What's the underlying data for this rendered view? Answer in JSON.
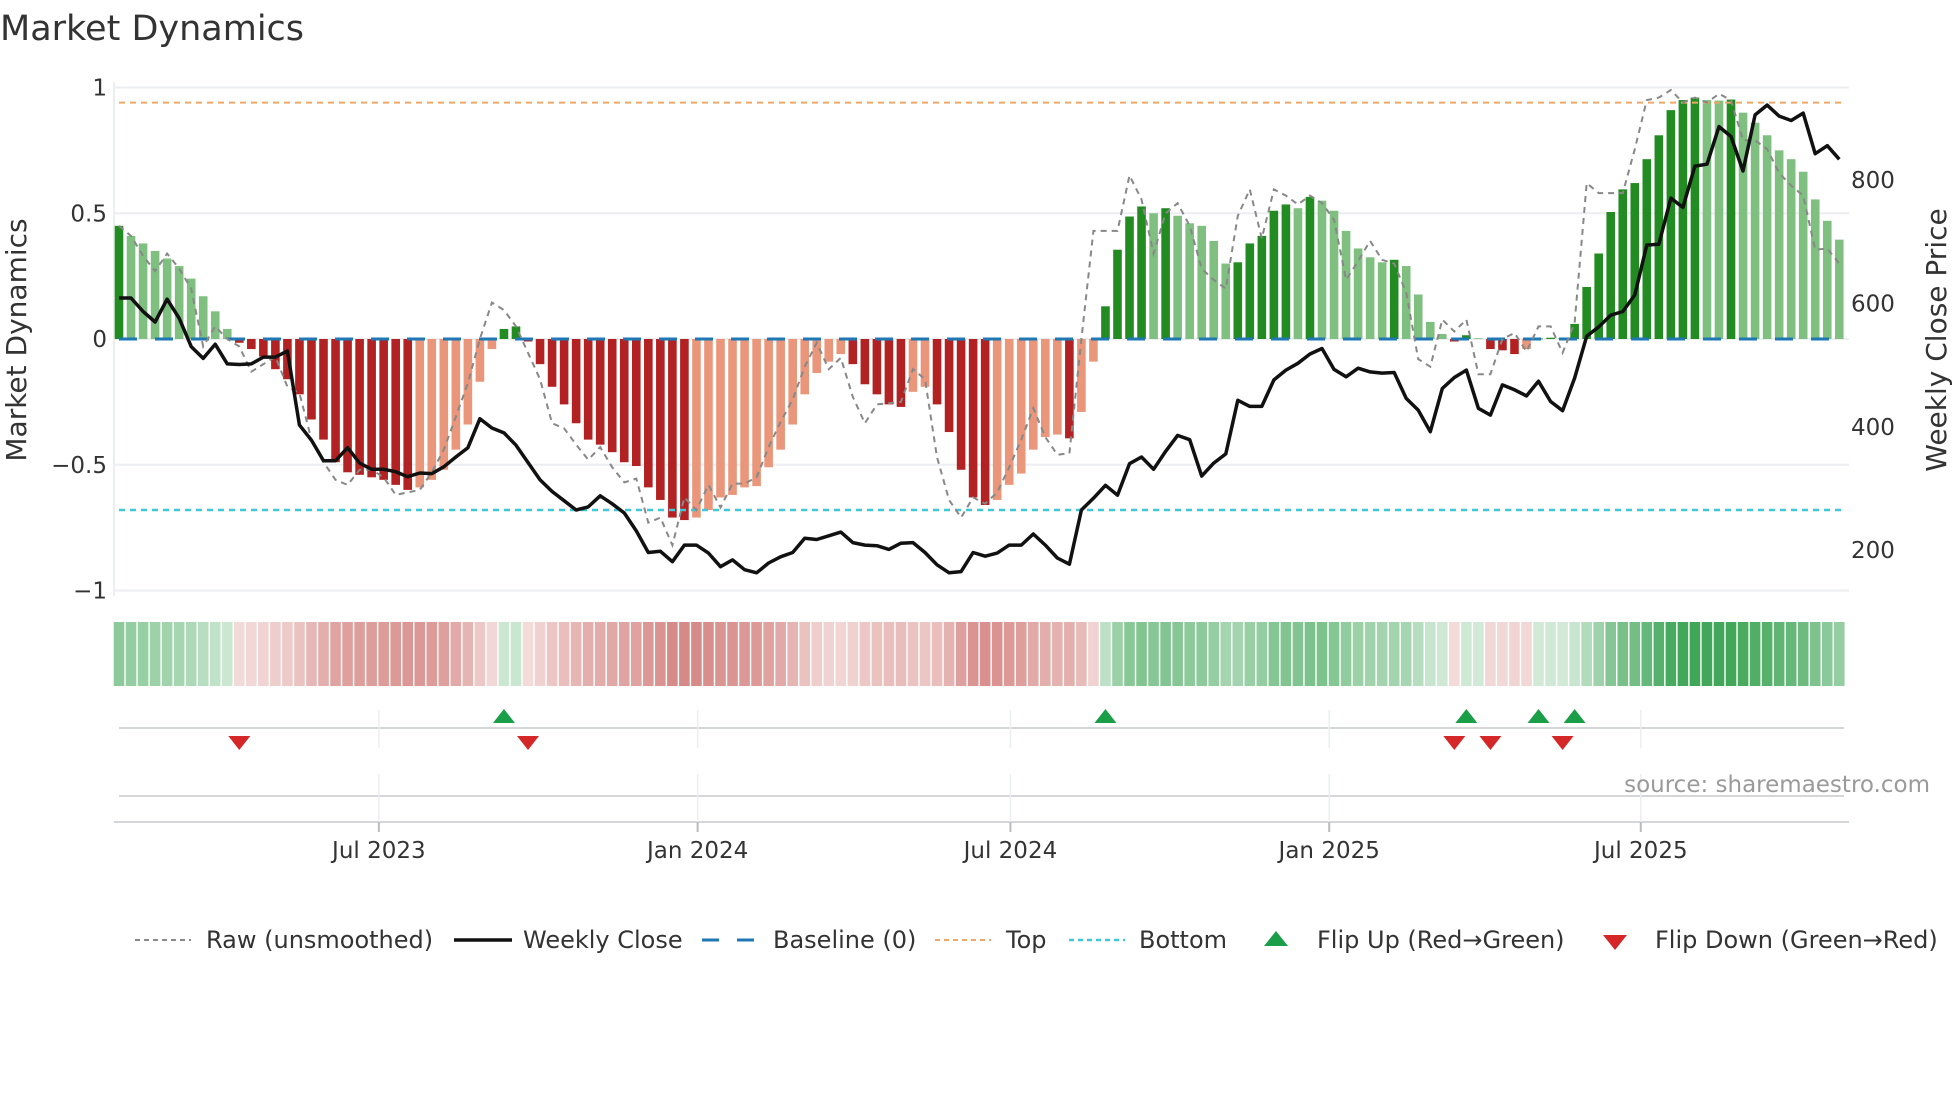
{
  "chart_data": {
    "type": "bar",
    "title": "Market Dynamics",
    "ylabel": "Market Dynamics",
    "y2label": "Weekly Close Price",
    "ylim": [
      -1,
      1
    ],
    "y2lim": [
      100,
      940
    ],
    "yticks": [
      {
        "v": 1,
        "label": "1"
      },
      {
        "v": 0.5,
        "label": "0.5"
      },
      {
        "v": 0,
        "label": "0"
      },
      {
        "v": -0.5,
        "label": "−0.5"
      },
      {
        "v": -1,
        "label": "−1"
      }
    ],
    "y2ticks": [
      {
        "v": 800,
        "label": "800"
      },
      {
        "v": 600,
        "label": "600"
      },
      {
        "v": 400,
        "label": "400"
      },
      {
        "v": 200,
        "label": "200"
      }
    ],
    "xticks": [
      {
        "week": 21.6,
        "label": "Jul 2023"
      },
      {
        "week": 48.1,
        "label": "Jan 2024"
      },
      {
        "week": 74.1,
        "label": "Jul 2024"
      },
      {
        "week": 100.6,
        "label": "Jan 2025"
      },
      {
        "week": 126.5,
        "label": "Jul 2025"
      }
    ],
    "grid": true,
    "top_level": 0.94,
    "bottom_level": -0.68,
    "baseline": 0,
    "series": [
      {
        "name": "Market Dynamics (smoothed)",
        "type": "bar",
        "values": [
          0.45,
          0.41,
          0.38,
          0.35,
          0.32,
          0.29,
          0.24,
          0.17,
          0.11,
          0.04,
          -0.015,
          -0.04,
          -0.07,
          -0.12,
          -0.16,
          -0.22,
          -0.32,
          -0.4,
          -0.49,
          -0.53,
          -0.54,
          -0.55,
          -0.56,
          -0.58,
          -0.6,
          -0.59,
          -0.56,
          -0.52,
          -0.44,
          -0.34,
          -0.17,
          -0.04,
          0.04,
          0.05,
          -0.01,
          -0.1,
          -0.19,
          -0.26,
          -0.335,
          -0.4,
          -0.42,
          -0.45,
          -0.49,
          -0.505,
          -0.59,
          -0.64,
          -0.71,
          -0.72,
          -0.71,
          -0.68,
          -0.63,
          -0.62,
          -0.59,
          -0.585,
          -0.51,
          -0.44,
          -0.34,
          -0.22,
          -0.135,
          -0.09,
          -0.06,
          -0.1,
          -0.18,
          -0.22,
          -0.26,
          -0.27,
          -0.21,
          -0.19,
          -0.26,
          -0.37,
          -0.52,
          -0.63,
          -0.66,
          -0.64,
          -0.58,
          -0.535,
          -0.44,
          -0.39,
          -0.38,
          -0.395,
          -0.29,
          -0.09,
          0.13,
          0.355,
          0.487,
          0.527,
          0.5,
          0.52,
          0.49,
          0.46,
          0.45,
          0.39,
          0.3,
          0.305,
          0.38,
          0.41,
          0.51,
          0.535,
          0.52,
          0.565,
          0.55,
          0.51,
          0.43,
          0.36,
          0.325,
          0.305,
          0.315,
          0.29,
          0.177,
          0.068,
          0.02,
          -0.01,
          0.015,
          0.003,
          -0.04,
          -0.045,
          -0.06,
          -0.04,
          0.002,
          0.005,
          0.003,
          0.06,
          0.207,
          0.34,
          0.505,
          0.595,
          0.62,
          0.715,
          0.81,
          0.91,
          0.95,
          0.96,
          0.95,
          0.948,
          0.952,
          0.9,
          0.86,
          0.81,
          0.75,
          0.715,
          0.665,
          0.555,
          0.47,
          0.395
        ]
      },
      {
        "name": "Raw (unsmoothed)",
        "type": "line",
        "values": [
          0.45,
          0.41,
          0.33,
          0.27,
          0.34,
          0.28,
          0.2,
          -0.03,
          0.05,
          0.0,
          -0.03,
          -0.13,
          -0.1,
          -0.07,
          -0.19,
          -0.215,
          -0.4,
          -0.49,
          -0.56,
          -0.58,
          -0.52,
          -0.52,
          -0.55,
          -0.62,
          -0.61,
          -0.6,
          -0.53,
          -0.44,
          -0.31,
          -0.175,
          0.0,
          0.145,
          0.115,
          0.05,
          -0.055,
          -0.16,
          -0.335,
          -0.355,
          -0.42,
          -0.48,
          -0.43,
          -0.51,
          -0.57,
          -0.555,
          -0.73,
          -0.71,
          -0.82,
          -0.63,
          -0.68,
          -0.58,
          -0.67,
          -0.575,
          -0.575,
          -0.55,
          -0.43,
          -0.33,
          -0.24,
          -0.11,
          -0.015,
          -0.12,
          -0.075,
          -0.23,
          -0.335,
          -0.26,
          -0.255,
          -0.25,
          -0.12,
          -0.16,
          -0.47,
          -0.64,
          -0.71,
          -0.63,
          -0.655,
          -0.61,
          -0.51,
          -0.4,
          -0.275,
          -0.39,
          -0.46,
          -0.455,
          0.0,
          0.43,
          0.43,
          0.43,
          0.65,
          0.555,
          0.34,
          0.5,
          0.54,
          0.45,
          0.28,
          0.235,
          0.2,
          0.49,
          0.595,
          0.4,
          0.595,
          0.57,
          0.535,
          0.57,
          0.54,
          0.475,
          0.235,
          0.31,
          0.39,
          0.315,
          0.3,
          0.185,
          -0.08,
          -0.11,
          0.077,
          0.03,
          0.077,
          -0.14,
          -0.14,
          0.0,
          0.024,
          -0.05,
          0.05,
          0.05,
          -0.055,
          0.064,
          0.62,
          0.58,
          0.58,
          0.58,
          0.755,
          0.95,
          0.96,
          0.99,
          0.94,
          0.96,
          0.94,
          0.975,
          0.95,
          0.79,
          0.79,
          0.755,
          0.66,
          0.61,
          0.57,
          0.355,
          0.36,
          0.3
        ]
      },
      {
        "name": "Weekly Close",
        "type": "line",
        "axis": "right",
        "values": [
          609,
          609,
          587,
          570,
          607,
          576,
          530,
          511,
          534,
          502,
          501,
          502,
          513,
          513,
          523,
          403,
          378,
          345,
          345,
          366,
          341,
          331,
          331,
          327,
          319,
          325,
          324,
          335,
          351,
          366,
          413,
          398,
          390,
          370,
          342,
          314,
          295,
          280,
          265,
          270,
          288,
          275,
          260,
          231,
          196,
          198,
          181,
          208,
          208,
          195,
          173,
          184,
          168,
          163,
          179,
          189,
          196,
          219,
          217,
          223,
          229,
          212,
          208,
          207,
          201,
          211,
          212,
          196,
          176,
          163,
          165,
          196,
          190,
          195,
          208,
          208,
          226,
          208,
          187,
          177,
          265,
          284,
          305,
          289,
          340,
          351,
          331,
          360,
          386,
          379,
          320,
          341,
          356,
          443,
          433,
          433,
          476,
          492,
          503,
          518,
          527,
          493,
          481,
          495,
          489,
          487,
          488,
          446,
          427,
          392,
          462,
          480,
          492,
          430,
          419,
          468,
          460,
          450,
          474,
          441,
          426,
          479,
          547,
          562,
          581,
          587,
          614,
          695,
          696,
          771,
          756,
          823,
          826,
          887,
          871,
          815,
          906,
          922,
          904,
          897,
          909,
          843,
          856,
          834
        ]
      }
    ],
    "flips_up_weeks": [
      32,
      82,
      112,
      118,
      121
    ],
    "flips_down_weeks": [
      10,
      34,
      111,
      114,
      120
    ],
    "legend": {
      "placement": "bottom",
      "items": [
        "Raw (unsmoothed)",
        "Weekly Close",
        "Baseline (0)",
        "Top",
        "Bottom",
        "Flip Up (Red→Green)",
        "Flip Down (Green→Red)"
      ]
    },
    "source": "source: sharemaestro.com"
  },
  "colors": {
    "bar_up_pos": "#228b22",
    "bar_down_pos": "#7fbf7f",
    "bar_down_neg": "#b22222",
    "bar_up_neg": "#e9967a",
    "raw": "#888888",
    "close": "#111111",
    "baseline": "#1f77b4",
    "top": "#f0a868",
    "bottom": "#3fc8d6",
    "flip_up": "#1a9e48",
    "flip_down": "#d62728",
    "heat_green": "#2e9e48",
    "heat_red": "#c8605c"
  }
}
